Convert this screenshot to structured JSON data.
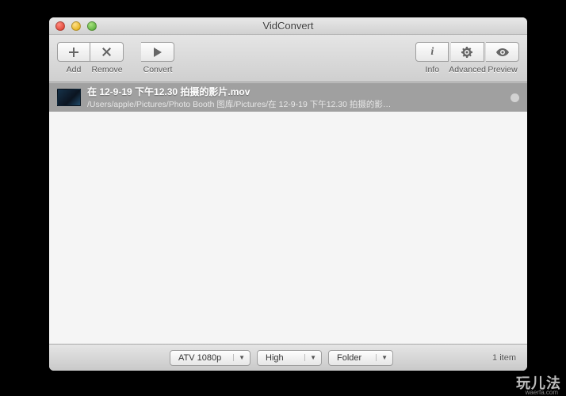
{
  "window": {
    "title": "VidConvert"
  },
  "toolbar": {
    "add": "Add",
    "remove": "Remove",
    "convert": "Convert",
    "info": "Info",
    "advanced": "Advanced",
    "preview": "Preview"
  },
  "list": {
    "items": [
      {
        "title": "在 12-9-19 下午12.30 拍摄的影片.mov",
        "subtitle": "/Users/apple/Pictures/Photo Booth 图库/Pictures/在 12-9-19 下午12.30 拍摄的影…"
      }
    ]
  },
  "bottom": {
    "preset": "ATV 1080p",
    "quality": "High",
    "destination": "Folder",
    "count": "1 item"
  },
  "watermark": {
    "main": "玩儿法",
    "sub": "waerfa.com"
  }
}
